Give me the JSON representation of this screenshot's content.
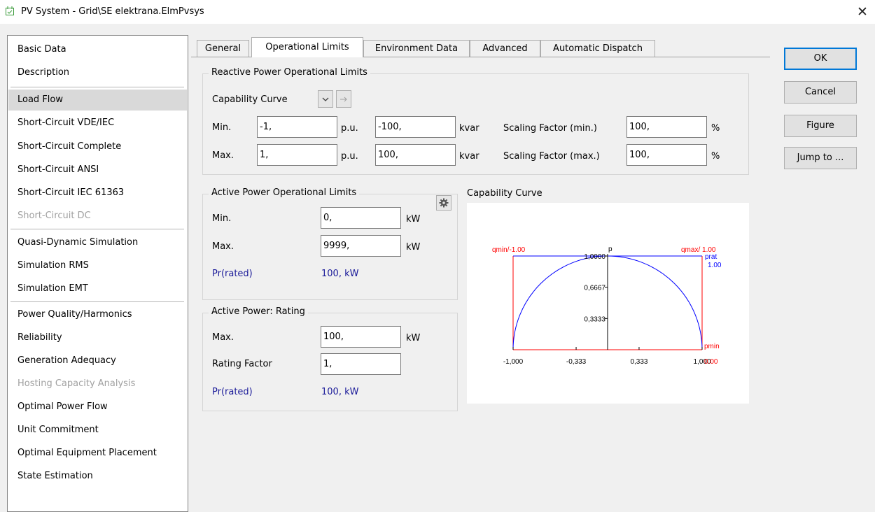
{
  "window": {
    "title": "PV System - Grid\\SE elektrana.ElmPvsys",
    "close_glyph": "✕"
  },
  "nav": {
    "items": [
      {
        "label": "Basic Data",
        "state": "normal"
      },
      {
        "label": "Description",
        "state": "normal"
      },
      {
        "label": "Load Flow",
        "state": "selected"
      },
      {
        "label": "Short-Circuit VDE/IEC",
        "state": "normal"
      },
      {
        "label": "Short-Circuit Complete",
        "state": "normal"
      },
      {
        "label": "Short-Circuit ANSI",
        "state": "normal"
      },
      {
        "label": "Short-Circuit IEC 61363",
        "state": "normal"
      },
      {
        "label": "Short-Circuit DC",
        "state": "disabled"
      },
      {
        "label": "Quasi-Dynamic Simulation",
        "state": "normal"
      },
      {
        "label": "Simulation RMS",
        "state": "normal"
      },
      {
        "label": "Simulation EMT",
        "state": "normal"
      },
      {
        "label": "Power Quality/Harmonics",
        "state": "normal"
      },
      {
        "label": "Reliability",
        "state": "normal"
      },
      {
        "label": "Generation Adequacy",
        "state": "normal"
      },
      {
        "label": "Hosting Capacity Analysis",
        "state": "disabled"
      },
      {
        "label": "Optimal Power Flow",
        "state": "normal"
      },
      {
        "label": "Unit Commitment",
        "state": "normal"
      },
      {
        "label": "Optimal Equipment Placement",
        "state": "normal"
      },
      {
        "label": "State Estimation",
        "state": "normal"
      }
    ]
  },
  "tabs": [
    {
      "label": "General",
      "active": false
    },
    {
      "label": "Operational Limits",
      "active": true
    },
    {
      "label": "Environment Data",
      "active": false
    },
    {
      "label": "Advanced",
      "active": false
    },
    {
      "label": "Automatic Dispatch",
      "active": false
    }
  ],
  "buttons": {
    "ok": "OK",
    "cancel": "Cancel",
    "figure": "Figure",
    "jump": "Jump to ..."
  },
  "reactive": {
    "title": "Reactive Power Operational Limits",
    "capability_curve_label": "Capability Curve",
    "dropdown_icon": "chevron-down",
    "arrow_icon": "arrow-right",
    "min_label": "Min.",
    "max_label": "Max.",
    "min_pu": "-1,",
    "max_pu": "1,",
    "pu_unit": "p.u.",
    "min_kvar": "-100,",
    "max_kvar": "100,",
    "kvar_unit": "kvar",
    "scale_min_label": "Scaling Factor (min.)",
    "scale_max_label": "Scaling Factor (max.)",
    "scale_min": "100,",
    "scale_max": "100,",
    "pct_unit": "%"
  },
  "active_limits": {
    "title": "Active Power Operational Limits",
    "settings_icon": "gear",
    "min_label": "Min.",
    "max_label": "Max.",
    "min_value": "0,",
    "max_value": "9999,",
    "unit": "kW",
    "prated_label": "Pr(rated)",
    "prated_value": "100, kW"
  },
  "rating": {
    "title": "Active Power: Rating",
    "max_label": "Max.",
    "max_value": "100,",
    "unit": "kW",
    "factor_label": "Rating Factor",
    "factor_value": "1,",
    "prated_label": "Pr(rated)",
    "prated_value": "100, kW"
  },
  "capability": {
    "title": "Capability Curve",
    "colors": {
      "curve": "#0000ff",
      "limits": "#ff0000",
      "axis": "#000000"
    }
  },
  "chart_data": {
    "type": "line",
    "title": "Capability Curve",
    "xlabel": "",
    "ylabel": "p",
    "xlim": [
      -1.0,
      1.0
    ],
    "ylim": [
      0,
      1.0
    ],
    "x_tick_labels": [
      "-1,000",
      "-0,333",
      "0,333",
      "1,000"
    ],
    "x_ticks": [
      -1.0,
      -0.333,
      0.333,
      1.0
    ],
    "y_tick_labels": [
      "0,3333",
      "0,6667",
      "1,0000"
    ],
    "y_ticks": [
      0.3333,
      0.6667,
      1.0
    ],
    "annotations": {
      "qmin": "qmin/-1.00",
      "qmax": "qmax/ 1.00",
      "prat": "prat",
      "prat_value": "1.00",
      "pmin": "pmin",
      "pmin_value": "0.00"
    },
    "series": [
      {
        "name": "prat",
        "values": [
          {
            "x": -1.0,
            "y": 0.0
          },
          {
            "x": -0.8,
            "y": 0.6
          },
          {
            "x": -0.6,
            "y": 0.8
          },
          {
            "x": -0.4,
            "y": 0.917
          },
          {
            "x": -0.2,
            "y": 0.98
          },
          {
            "x": 0.0,
            "y": 1.0
          },
          {
            "x": 0.2,
            "y": 0.98
          },
          {
            "x": 0.4,
            "y": 0.917
          },
          {
            "x": 0.6,
            "y": 0.8
          },
          {
            "x": 0.8,
            "y": 0.6
          },
          {
            "x": 1.0,
            "y": 0.0
          }
        ]
      }
    ],
    "limits": {
      "qmin": -1.0,
      "qmax": 1.0,
      "pmax": 1.0,
      "pmin": 0.0
    }
  }
}
